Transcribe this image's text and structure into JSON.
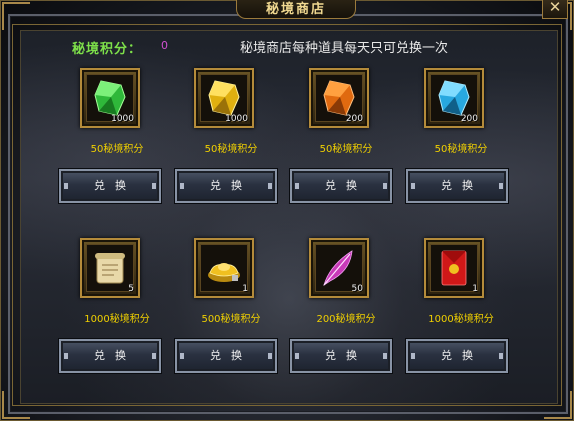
{
  "window": {
    "title": "秘境商店",
    "close_glyph": "✕"
  },
  "header": {
    "points_label": "秘境积分：",
    "points_value": "0",
    "notice": "秘境商店每种道具每天只可兑换一次"
  },
  "items": [
    {
      "icon": "green-crystal-icon",
      "quantity": "1000",
      "price": "50秘境积分",
      "button": "兑换",
      "color": "#3fd24a"
    },
    {
      "icon": "gold-crystal-icon",
      "quantity": "1000",
      "price": "50秘境积分",
      "button": "兑换",
      "color": "#f0c020"
    },
    {
      "icon": "orange-crystal-icon",
      "quantity": "200",
      "price": "50秘境积分",
      "button": "兑换",
      "color": "#f07a1a"
    },
    {
      "icon": "blue-crystal-icon",
      "quantity": "200",
      "price": "50秘境积分",
      "button": "兑换",
      "color": "#40c0f0"
    },
    {
      "icon": "scroll-icon",
      "quantity": "5",
      "price": "1000秘境积分",
      "button": "兑换",
      "color": "#e8d8a8"
    },
    {
      "icon": "gold-ingot-icon",
      "quantity": "1",
      "price": "500秘境积分",
      "button": "兑换",
      "color": "#f0c020"
    },
    {
      "icon": "feather-icon",
      "quantity": "50",
      "price": "200秘境积分",
      "button": "兑换",
      "color": "#d040c0"
    },
    {
      "icon": "red-envelope-icon",
      "quantity": "1",
      "price": "1000秘境积分",
      "button": "兑换",
      "color": "#d01818"
    }
  ]
}
